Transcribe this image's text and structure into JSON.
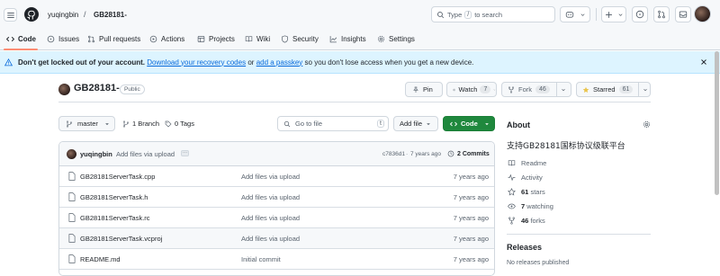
{
  "header": {
    "owner": "yuqingbin",
    "separator": "/",
    "repo": "GB28181-",
    "search_prefix": "Type",
    "search_key": "/",
    "search_suffix": "to search"
  },
  "tabs": [
    {
      "label": "Code",
      "icon": "code-icon"
    },
    {
      "label": "Issues",
      "icon": "issue-icon"
    },
    {
      "label": "Pull requests",
      "icon": "pull-request-icon"
    },
    {
      "label": "Actions",
      "icon": "play-icon"
    },
    {
      "label": "Projects",
      "icon": "table-icon"
    },
    {
      "label": "Wiki",
      "icon": "book-icon"
    },
    {
      "label": "Security",
      "icon": "shield-icon"
    },
    {
      "label": "Insights",
      "icon": "graph-icon"
    },
    {
      "label": "Settings",
      "icon": "gear-icon"
    }
  ],
  "banner": {
    "bold": "Don't get locked out of your account.",
    "link1": "Download your recovery codes",
    "or": "or",
    "link2": "add a passkey",
    "rest": "so you don't lose access when you get a new device."
  },
  "repo": {
    "name": "GB28181-",
    "visibility": "Public",
    "pin": "Pin",
    "watch": "Watch",
    "watch_count": "7",
    "fork": "Fork",
    "fork_count": "46",
    "starred": "Starred",
    "star_count": "61"
  },
  "toolbar": {
    "branch": "master",
    "branches": "1 Branch",
    "tags": "0 Tags",
    "goto_placeholder": "Go to file",
    "goto_key": "t",
    "add_file": "Add file",
    "code": "Code"
  },
  "commit": {
    "author": "yuqingbin",
    "message": "Add files via upload",
    "hash": "c7836d1",
    "dot": "·",
    "ago": "7 years ago",
    "commits": "2 Commits"
  },
  "files": [
    {
      "name": "GB28181ServerTask.cpp",
      "message": "Add files via upload",
      "time": "7 years ago"
    },
    {
      "name": "GB28181ServerTask.h",
      "message": "Add files via upload",
      "time": "7 years ago"
    },
    {
      "name": "GB28181ServerTask.rc",
      "message": "Add files via upload",
      "time": "7 years ago"
    },
    {
      "name": "GB28181ServerTask.vcproj",
      "message": "Add files via upload",
      "time": "7 years ago"
    },
    {
      "name": "README.md",
      "message": "Initial commit",
      "time": "7 years ago"
    }
  ],
  "about": {
    "title": "About",
    "description": "支持GB28181国标协议级联平台",
    "readme": "Readme",
    "activity": "Activity",
    "stars_num": "61",
    "stars_label": "stars",
    "watching_num": "7",
    "watching_label": "watching",
    "forks_num": "46",
    "forks_label": "forks"
  },
  "releases": {
    "title": "Releases",
    "empty": "No releases published"
  },
  "colors": {
    "accent_link": "#0969da",
    "code_button": "#1f883d",
    "tab_underline": "#fd8c73",
    "banner_bg": "#ddf4ff",
    "star_icon": "#eac54f"
  }
}
